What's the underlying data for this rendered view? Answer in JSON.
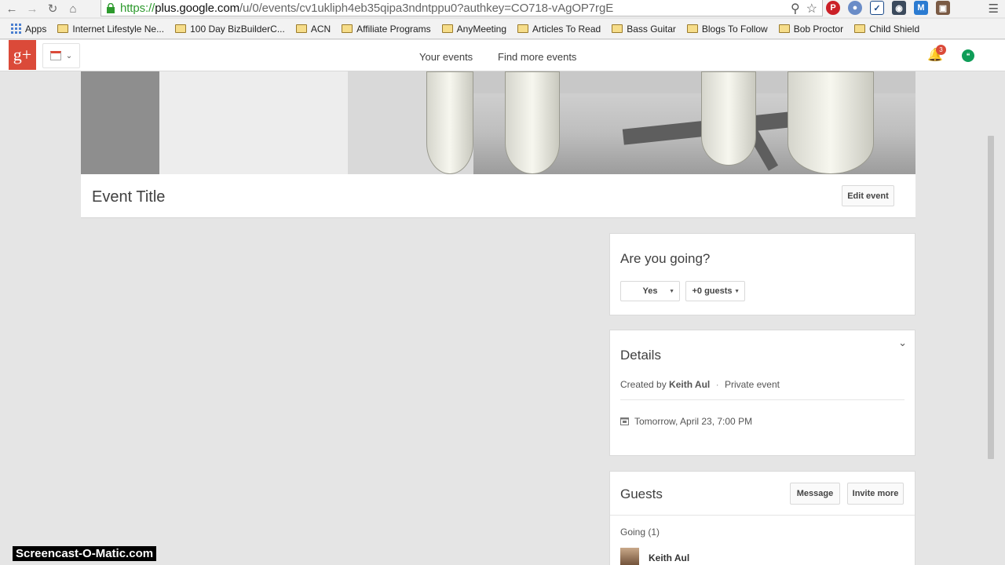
{
  "browser": {
    "url_host": "plus.google.com",
    "url_path": "/u/0/events/cv1ukliph4eb35qipa3ndntppu0?authkey=CO718-vAgOP7rgE",
    "url_scheme": "https://"
  },
  "bookmarks": [
    {
      "label": "Apps",
      "type": "apps"
    },
    {
      "label": "Internet Lifestyle Ne...",
      "type": "folder"
    },
    {
      "label": "100 Day BizBuilderC...",
      "type": "folder"
    },
    {
      "label": "ACN",
      "type": "folder"
    },
    {
      "label": "Affiliate Programs",
      "type": "folder"
    },
    {
      "label": "AnyMeeting",
      "type": "folder"
    },
    {
      "label": "Articles To Read",
      "type": "folder"
    },
    {
      "label": "Bass Guitar",
      "type": "folder"
    },
    {
      "label": "Blogs To Follow",
      "type": "folder"
    },
    {
      "label": "Bob Proctor",
      "type": "folder"
    },
    {
      "label": "Child Shield",
      "type": "folder"
    }
  ],
  "header": {
    "logo": "g+",
    "your_events": "Your events",
    "find_more_events": "Find more events",
    "notification_count": "3"
  },
  "event": {
    "title": "Event Title",
    "edit_button": "Edit event"
  },
  "rsvp": {
    "heading": "Are you going?",
    "response": "Yes",
    "guests": "+0 guests"
  },
  "details": {
    "heading": "Details",
    "created_by_label": "Created by",
    "creator": "Keith Aul",
    "separator": "·",
    "privacy": "Private event",
    "datetime": "Tomorrow, April 23, 7:00 PM"
  },
  "guests": {
    "heading": "Guests",
    "message_button": "Message",
    "invite_button": "Invite more",
    "going_label": "Going (1)",
    "guest_name": "Keith Aul"
  },
  "watermark": "Screencast-O-Matic.com",
  "colors": {
    "gplus_red": "#db4a39",
    "page_bg": "#e5e5e5"
  }
}
